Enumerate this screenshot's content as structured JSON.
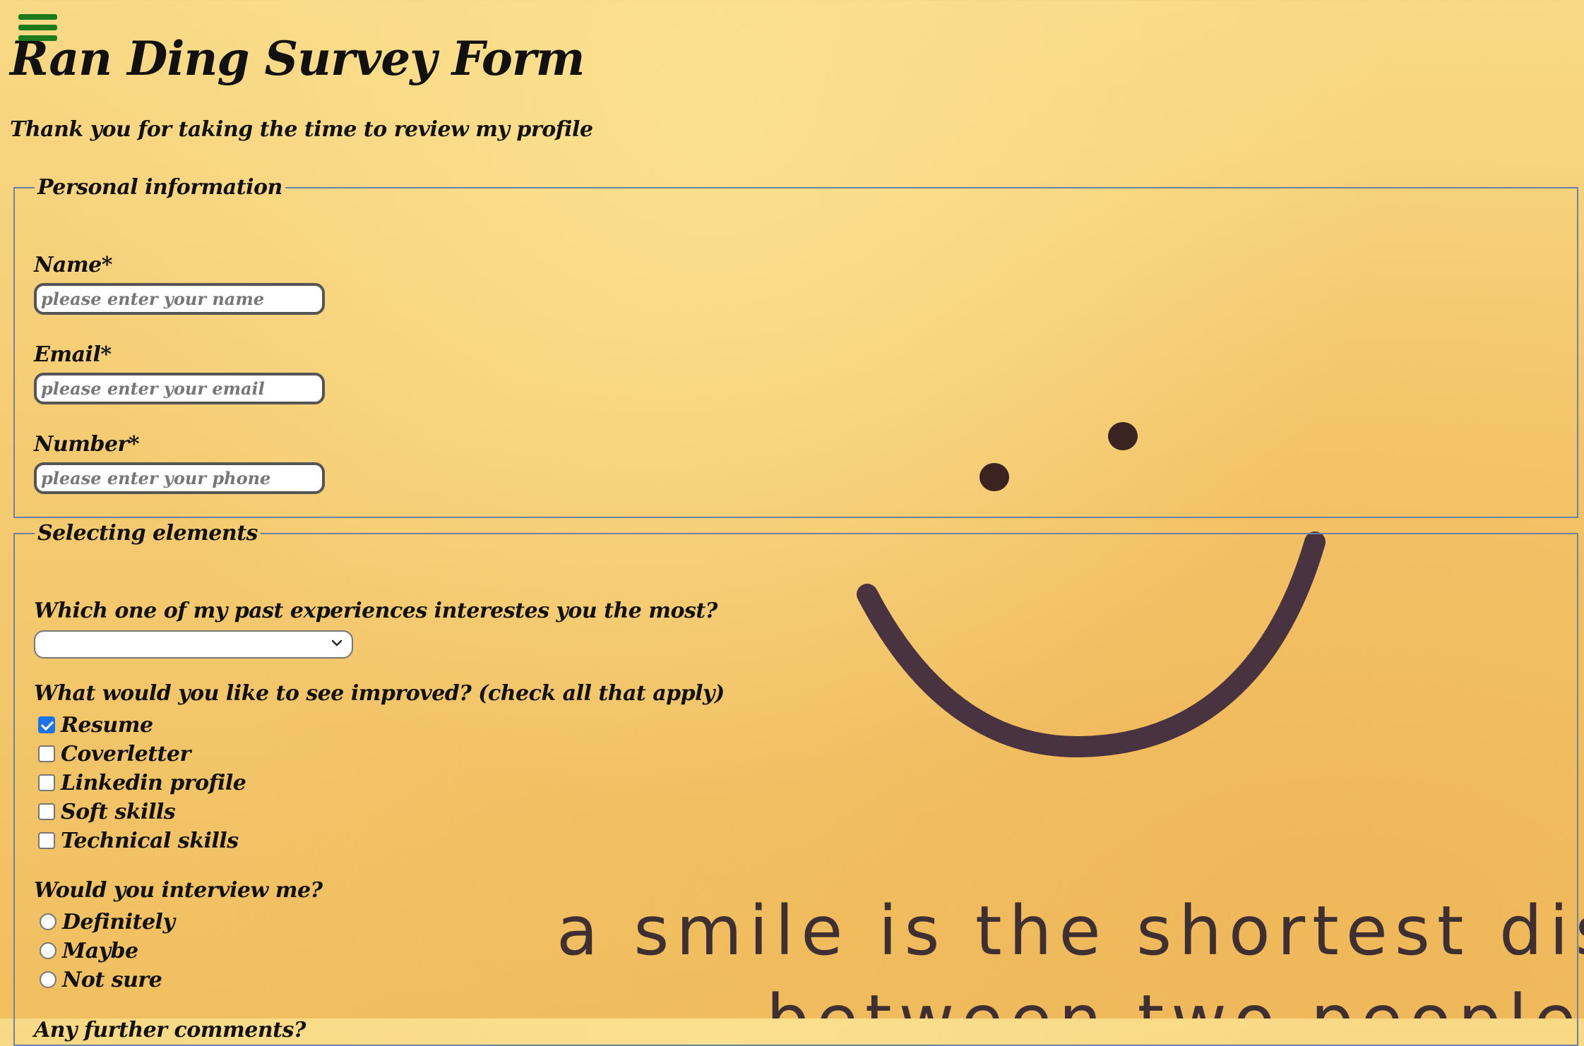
{
  "header": {
    "title": "Ran Ding Survey Form",
    "subtitle": "Thank you for taking the time to review my profile",
    "menu_icon": "hamburger-menu-icon",
    "menu_color": "#1b7b1b"
  },
  "background": {
    "quote_line1": "a smile is the shortest distan",
    "quote_line2": "between two people"
  },
  "personal": {
    "legend": "Personal information",
    "fields": [
      {
        "label": "Name*",
        "placeholder": "please enter your name",
        "value": ""
      },
      {
        "label": "Email*",
        "placeholder": "please enter your email",
        "value": ""
      },
      {
        "label": "Number*",
        "placeholder": "please enter your phone",
        "value": ""
      }
    ]
  },
  "selecting": {
    "legend": "Selecting elements",
    "dropdown": {
      "question": "Which one of my past experiences interestes you the most?",
      "selected": "",
      "icon": "chevron-down-icon"
    },
    "improve": {
      "question": "What would you like to see improved?  (check all that apply)",
      "options": [
        {
          "label": "Resume",
          "checked": true
        },
        {
          "label": "Coverletter",
          "checked": false
        },
        {
          "label": "Linkedin profile",
          "checked": false
        },
        {
          "label": "Soft skills",
          "checked": false
        },
        {
          "label": "Technical skills",
          "checked": false
        }
      ]
    },
    "interview": {
      "question": "Would you interview me?",
      "options": [
        {
          "label": "Definitely",
          "selected": false
        },
        {
          "label": "Maybe",
          "selected": false
        },
        {
          "label": "Not sure",
          "selected": false
        }
      ]
    },
    "comments": {
      "question": "Any further comments?"
    }
  },
  "colors": {
    "fieldset_border": "#6a84a8",
    "checkbox_accent": "#1a73e8"
  }
}
